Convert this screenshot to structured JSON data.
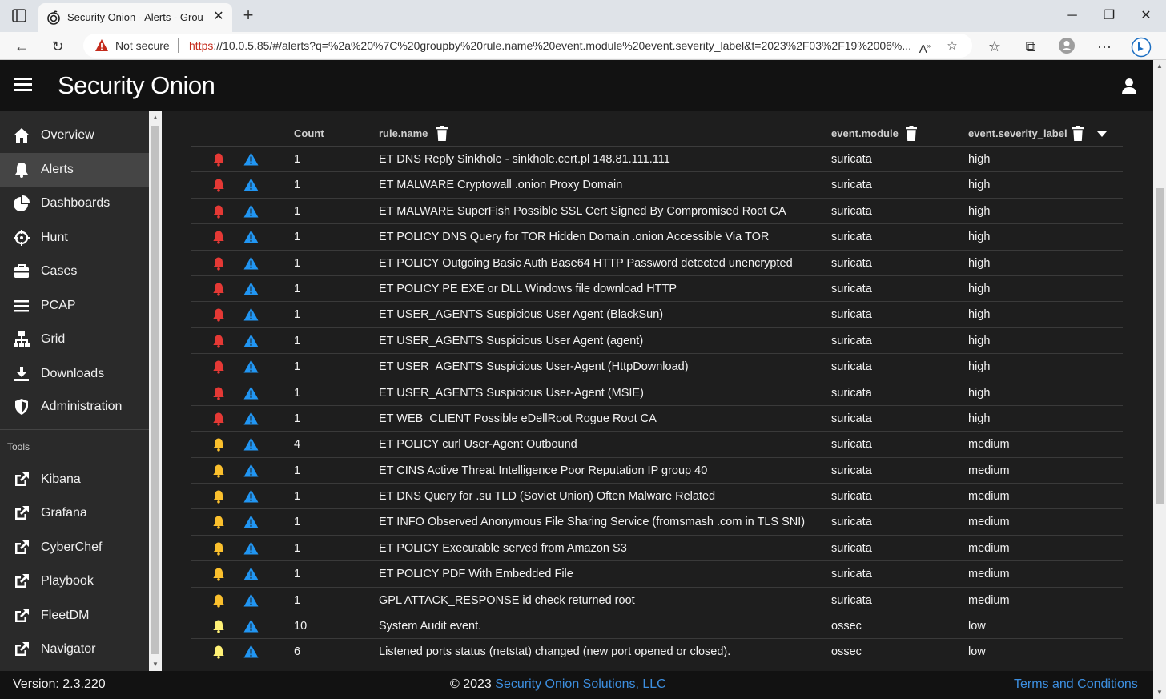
{
  "browser": {
    "tab_title": "Security Onion - Alerts - Group B",
    "not_secure": "Not secure",
    "url_https": "https",
    "url_rest": "://10.0.5.85/#/alerts?q=%2a%20%7C%20groupby%20rule.name%20event.module%20event.severity_label&t=2023%2F03%2F19%2006%..."
  },
  "app": {
    "logo": "Security Onion"
  },
  "sidebar": {
    "items": [
      {
        "label": "Overview",
        "icon": "home-icon"
      },
      {
        "label": "Alerts",
        "icon": "bell-icon"
      },
      {
        "label": "Dashboards",
        "icon": "pie-chart-icon"
      },
      {
        "label": "Hunt",
        "icon": "crosshair-icon"
      },
      {
        "label": "Cases",
        "icon": "briefcase-icon"
      },
      {
        "label": "PCAP",
        "icon": "list-icon"
      },
      {
        "label": "Grid",
        "icon": "network-icon"
      },
      {
        "label": "Downloads",
        "icon": "download-icon"
      },
      {
        "label": "Administration",
        "icon": "shield-icon"
      }
    ],
    "tools_label": "Tools",
    "tools": [
      {
        "label": "Kibana"
      },
      {
        "label": "Grafana"
      },
      {
        "label": "CyberChef"
      },
      {
        "label": "Playbook"
      },
      {
        "label": "FleetDM"
      },
      {
        "label": "Navigator"
      }
    ]
  },
  "table": {
    "headers": {
      "count": "Count",
      "rule": "rule.name",
      "module": "event.module",
      "severity": "event.severity_label"
    },
    "rows": [
      {
        "severity_color": "#e53935",
        "count": "1",
        "rule": "ET DNS Reply Sinkhole - sinkhole.cert.pl 148.81.111.111",
        "module": "suricata",
        "severity": "high"
      },
      {
        "severity_color": "#e53935",
        "count": "1",
        "rule": "ET MALWARE Cryptowall .onion Proxy Domain",
        "module": "suricata",
        "severity": "high"
      },
      {
        "severity_color": "#e53935",
        "count": "1",
        "rule": "ET MALWARE SuperFish Possible SSL Cert Signed By Compromised Root CA",
        "module": "suricata",
        "severity": "high"
      },
      {
        "severity_color": "#e53935",
        "count": "1",
        "rule": "ET POLICY DNS Query for TOR Hidden Domain .onion Accessible Via TOR",
        "module": "suricata",
        "severity": "high"
      },
      {
        "severity_color": "#e53935",
        "count": "1",
        "rule": "ET POLICY Outgoing Basic Auth Base64 HTTP Password detected unencrypted",
        "module": "suricata",
        "severity": "high"
      },
      {
        "severity_color": "#e53935",
        "count": "1",
        "rule": "ET POLICY PE EXE or DLL Windows file download HTTP",
        "module": "suricata",
        "severity": "high"
      },
      {
        "severity_color": "#e53935",
        "count": "1",
        "rule": "ET USER_AGENTS Suspicious User Agent (BlackSun)",
        "module": "suricata",
        "severity": "high"
      },
      {
        "severity_color": "#e53935",
        "count": "1",
        "rule": "ET USER_AGENTS Suspicious User Agent (agent)",
        "module": "suricata",
        "severity": "high"
      },
      {
        "severity_color": "#e53935",
        "count": "1",
        "rule": "ET USER_AGENTS Suspicious User-Agent (HttpDownload)",
        "module": "suricata",
        "severity": "high"
      },
      {
        "severity_color": "#e53935",
        "count": "1",
        "rule": "ET USER_AGENTS Suspicious User-Agent (MSIE)",
        "module": "suricata",
        "severity": "high"
      },
      {
        "severity_color": "#e53935",
        "count": "1",
        "rule": "ET WEB_CLIENT Possible eDellRoot Rogue Root CA",
        "module": "suricata",
        "severity": "high"
      },
      {
        "severity_color": "#fbc02d",
        "count": "4",
        "rule": "ET POLICY curl User-Agent Outbound",
        "module": "suricata",
        "severity": "medium"
      },
      {
        "severity_color": "#fbc02d",
        "count": "1",
        "rule": "ET CINS Active Threat Intelligence Poor Reputation IP group 40",
        "module": "suricata",
        "severity": "medium"
      },
      {
        "severity_color": "#fbc02d",
        "count": "1",
        "rule": "ET DNS Query for .su TLD (Soviet Union) Often Malware Related",
        "module": "suricata",
        "severity": "medium"
      },
      {
        "severity_color": "#fbc02d",
        "count": "1",
        "rule": "ET INFO Observed Anonymous File Sharing Service (fromsmash .com in TLS SNI)",
        "module": "suricata",
        "severity": "medium"
      },
      {
        "severity_color": "#fbc02d",
        "count": "1",
        "rule": "ET POLICY Executable served from Amazon S3",
        "module": "suricata",
        "severity": "medium"
      },
      {
        "severity_color": "#fbc02d",
        "count": "1",
        "rule": "ET POLICY PDF With Embedded File",
        "module": "suricata",
        "severity": "medium"
      },
      {
        "severity_color": "#fbc02d",
        "count": "1",
        "rule": "GPL ATTACK_RESPONSE id check returned root",
        "module": "suricata",
        "severity": "medium"
      },
      {
        "severity_color": "#fff176",
        "count": "10",
        "rule": "System Audit event.",
        "module": "ossec",
        "severity": "low"
      },
      {
        "severity_color": "#fff176",
        "count": "6",
        "rule": "Listened ports status (netstat) changed (new port opened or closed).",
        "module": "ossec",
        "severity": "low"
      }
    ]
  },
  "footer": {
    "version": "Version: 2.3.220",
    "copyright_prefix": "© 2023 ",
    "copyright_link": "Security Onion Solutions, LLC",
    "terms": "Terms and Conditions"
  },
  "colors": {
    "accent": "#3d8fe0",
    "escalate": "#2196f3",
    "high": "#e53935",
    "medium": "#fbc02d",
    "low": "#fff176"
  }
}
